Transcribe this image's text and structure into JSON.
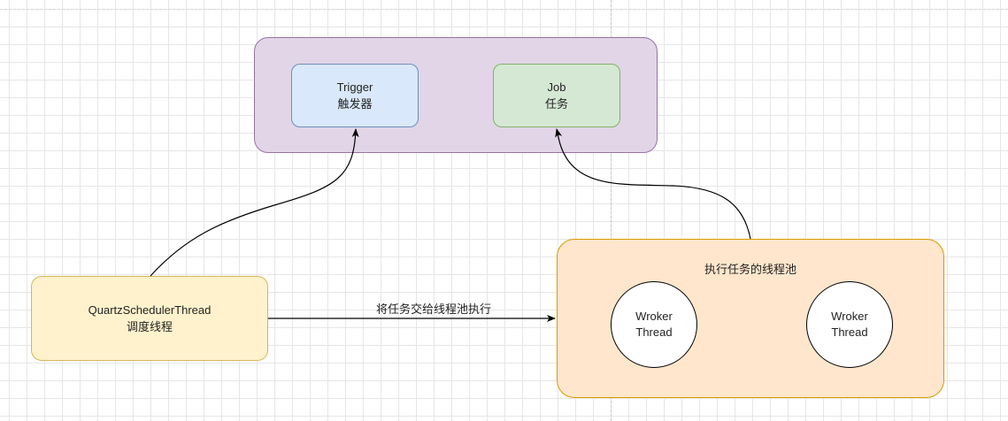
{
  "diagram": {
    "group": {},
    "trigger": {
      "label": "Trigger\n触发器"
    },
    "job": {
      "label": "Job\n任务"
    },
    "scheduler": {
      "label": "QuartzSchedulerThread\n调度线程"
    },
    "pool": {
      "title": "执行任务的线程池",
      "workers": [
        {
          "label": "Wroker\nThread"
        },
        {
          "label": "Wroker\nThread"
        }
      ]
    },
    "edges": {
      "dispatch_label": "将任务交给线程池执行"
    }
  }
}
